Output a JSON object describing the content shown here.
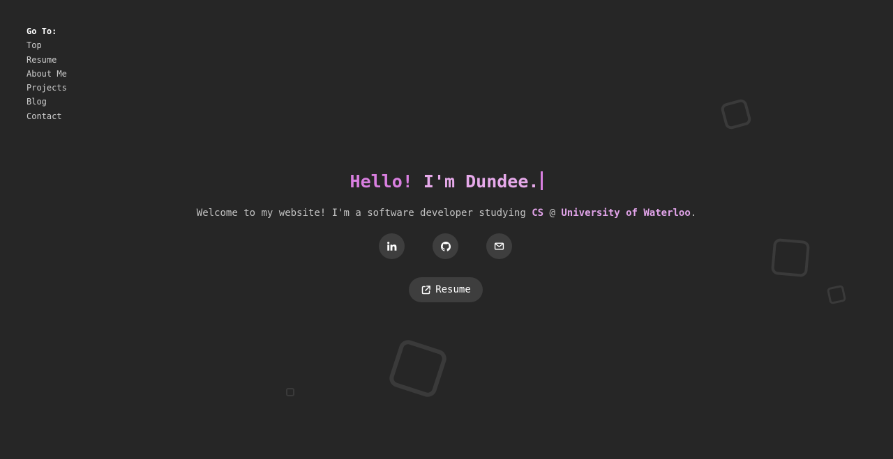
{
  "nav": {
    "heading": "Go To:",
    "items": [
      {
        "label": "Top"
      },
      {
        "label": "Resume"
      },
      {
        "label": "About Me"
      },
      {
        "label": "Projects"
      },
      {
        "label": "Blog"
      },
      {
        "label": "Contact"
      }
    ]
  },
  "hero": {
    "title_part1": "Hello!",
    "title_part2": " I'm Dundee.",
    "subtitle_prefix": "Welcome to my website! I'm a software developer studying ",
    "subtitle_cs": "CS",
    "subtitle_at": " @ ",
    "subtitle_school": "University of Waterloo",
    "subtitle_suffix": "."
  },
  "social": [
    {
      "icon": "linkedin-icon"
    },
    {
      "icon": "github-icon"
    },
    {
      "icon": "mail-icon"
    }
  ],
  "resume_button": {
    "label": "Resume",
    "icon": "external-link-icon"
  },
  "colors": {
    "background": "#262626",
    "accent": "#d97fe0",
    "button_bg": "#3e3e3e"
  }
}
